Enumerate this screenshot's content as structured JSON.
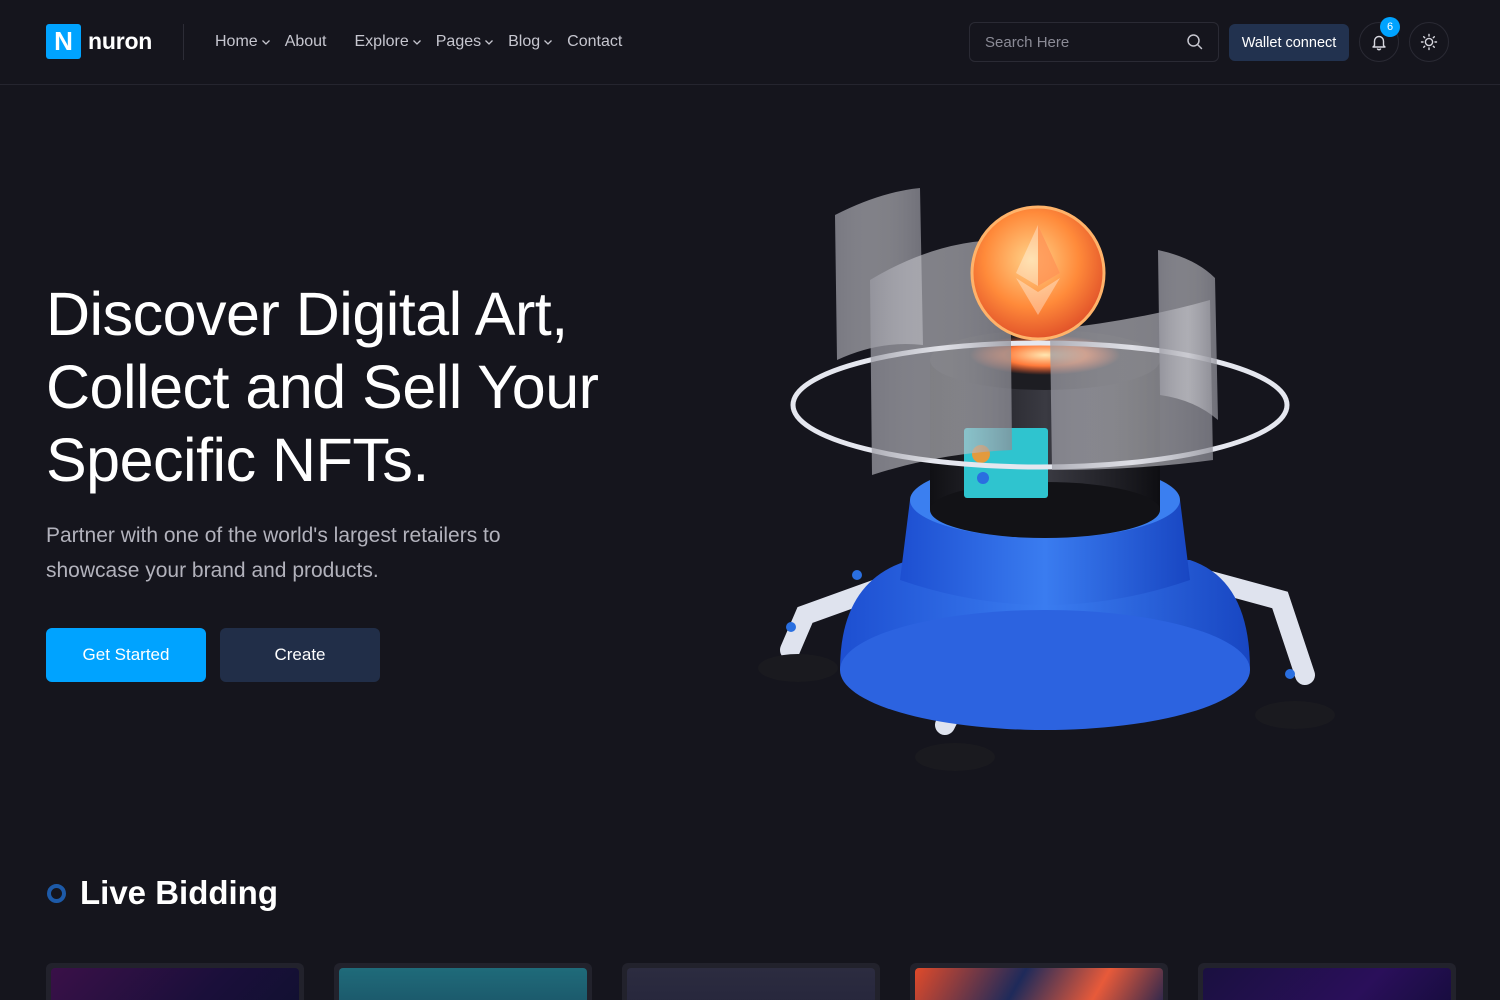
{
  "header": {
    "logo_mark": "N",
    "logo_text": "nuron",
    "nav": [
      {
        "label": "Home",
        "has_dropdown": true
      },
      {
        "label": "About",
        "has_dropdown": false
      },
      {
        "label": "Explore",
        "has_dropdown": true
      },
      {
        "label": "Pages",
        "has_dropdown": true
      },
      {
        "label": "Blog",
        "has_dropdown": true
      },
      {
        "label": "Contact",
        "has_dropdown": false
      }
    ],
    "search_placeholder": "Search Here",
    "wallet_label": "Wallet connect",
    "notification_count": "6",
    "icons": {
      "search": "search-icon",
      "bell": "bell-icon",
      "theme": "sun-icon"
    }
  },
  "hero": {
    "title_lines": [
      "Discover Digital Art,",
      "Collect and Sell Your",
      "Specific NFTs."
    ],
    "subtitle_lines": [
      "Partner with one of the world's largest retailers to",
      "showcase your brand and products."
    ],
    "primary_button": "Get Started",
    "secondary_button": "Create"
  },
  "live_bidding": {
    "title": "Live Bidding"
  },
  "colors": {
    "background": "#15151d",
    "accent": "#00a3ff",
    "secondary_button": "#212e48",
    "wallet_button": "#22324f"
  }
}
